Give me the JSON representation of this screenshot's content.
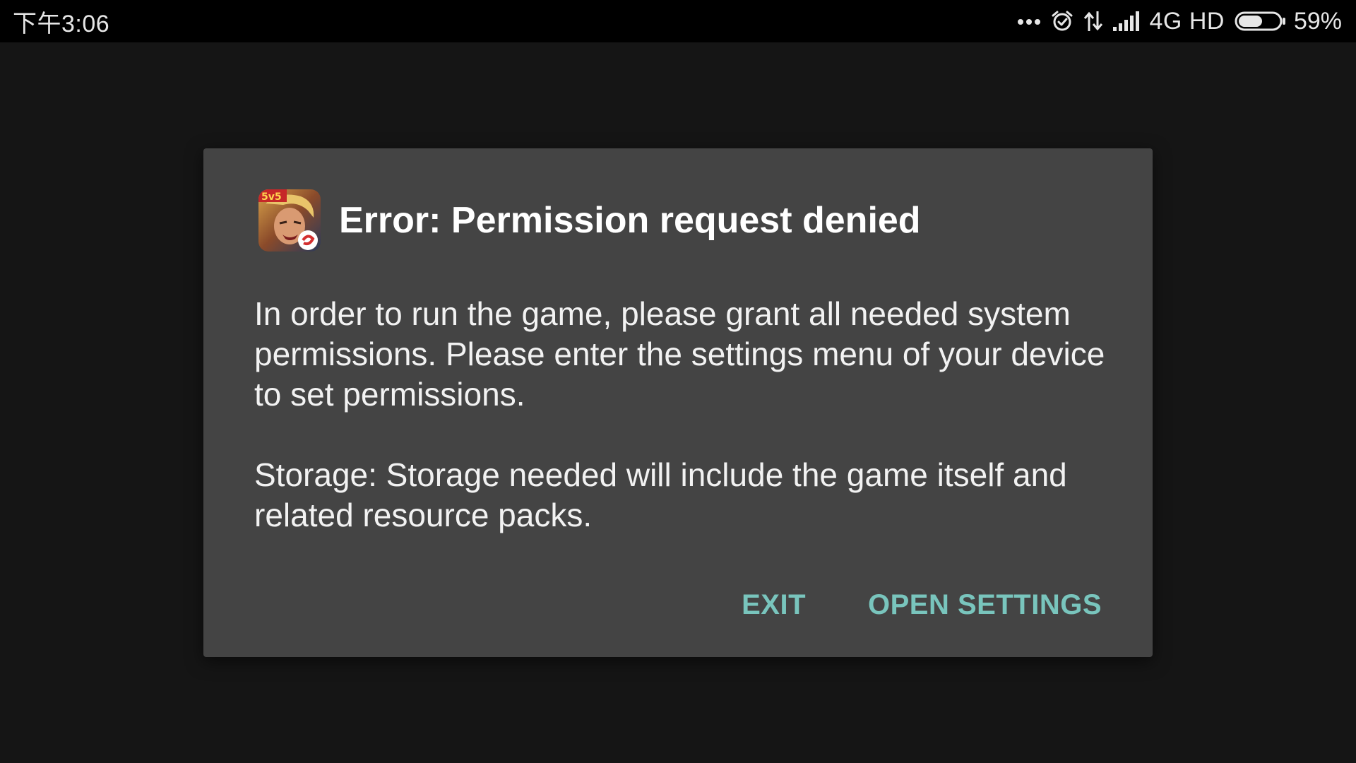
{
  "status_bar": {
    "time": "下午3:06",
    "network": "4G HD",
    "battery_percent": "59%",
    "battery_level": 0.59,
    "icons": [
      "more-dots-icon",
      "alarm-icon",
      "data-transfer-icon",
      "signal-icon",
      "battery-icon"
    ]
  },
  "dialog": {
    "app_icon": "game-app-icon",
    "app_icon_badge": "5v5",
    "title": "Error: Permission request denied",
    "message": "In order to run the game, please grant all needed system permissions. Please enter the settings menu of your device to set permissions.",
    "storage_note": "Storage: Storage needed will include the game itself and related resource packs.",
    "buttons": {
      "exit": "EXIT",
      "open_settings": "OPEN SETTINGS"
    },
    "accent_color": "#79c5bd"
  }
}
